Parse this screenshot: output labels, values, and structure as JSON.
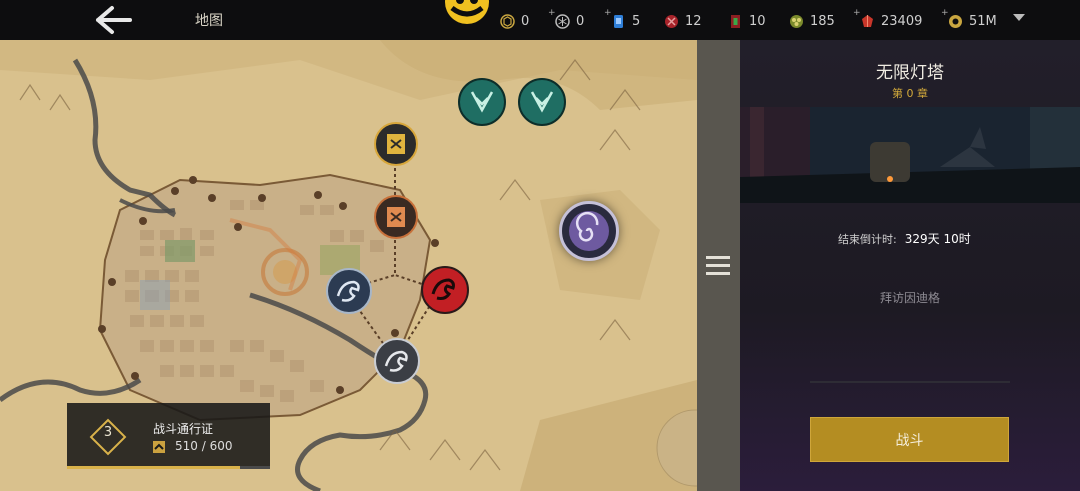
{
  "header": {
    "title": "地图",
    "resources": [
      {
        "icon": "rune-cube-icon",
        "value": "0",
        "plus": false
      },
      {
        "icon": "rune-hex-icon",
        "value": "0",
        "plus": true
      },
      {
        "icon": "blue-card-icon",
        "value": "5",
        "plus": true
      },
      {
        "icon": "red-token-icon",
        "value": "12",
        "plus": false
      },
      {
        "icon": "ticket-icon",
        "value": "10",
        "plus": false
      },
      {
        "icon": "gold-coins-icon",
        "value": "185",
        "plus": false
      },
      {
        "icon": "red-gem-icon",
        "value": "23409",
        "plus": true
      },
      {
        "icon": "gold-ring-icon",
        "value": "51M",
        "plus": true
      }
    ]
  },
  "battle_pass": {
    "level": "3",
    "name": "战斗通行证",
    "progress": "510 / 600",
    "fraction": 0.85
  },
  "panel": {
    "title": "无限灯塔",
    "chapter": "第 0 章",
    "countdown_label": "结束倒计时:",
    "countdown_value": "329天 10时",
    "visit_text": "拜访因迪格",
    "fight_label": "战斗"
  },
  "colors": {
    "gold": "#b48d22",
    "panel_bg": "#221f2a",
    "map_parchment": "#d8c08c"
  }
}
